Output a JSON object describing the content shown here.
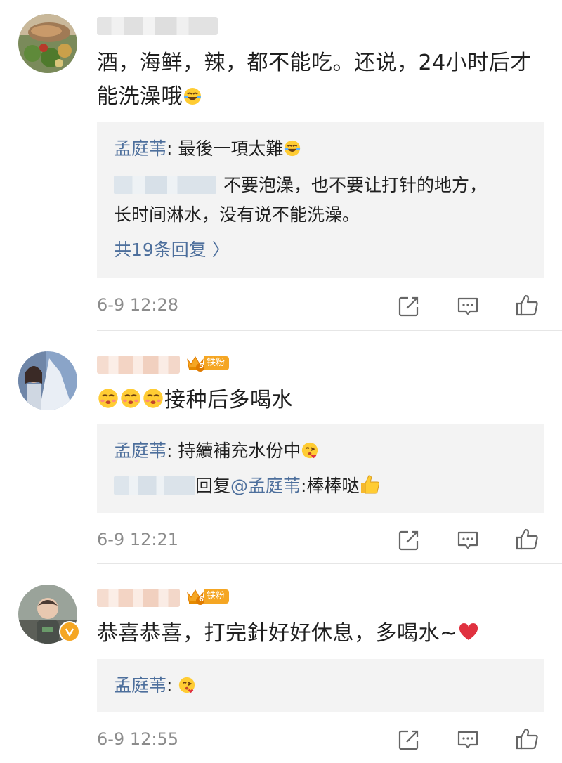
{
  "comments": [
    {
      "text": "酒，海鲜，辣，都不能吃。还说，24小时后才能洗澡哦",
      "replies": [
        {
          "name": "孟庭苇",
          "sep": ": ",
          "text": "最後一項太難"
        },
        {
          "text": "不要泡澡，也不要让打针的地方，",
          "text2": "长时间淋水，没有说不能洗澡。"
        }
      ],
      "more": "共19条回复 〉",
      "time": "6-9 12:28"
    },
    {
      "badge": {
        "level": "5",
        "label": "铁粉"
      },
      "text": "接种后多喝水",
      "replies": [
        {
          "name": "孟庭苇",
          "sep": ": ",
          "text": "持續補充水份中"
        },
        {
          "prefix": "回复",
          "mention": "@孟庭苇",
          "text": ":棒棒哒"
        }
      ],
      "time": "6-9 12:21"
    },
    {
      "badge": {
        "level": "6",
        "label": "铁粉"
      },
      "text": "恭喜恭喜，打完針好好休息，多喝水~",
      "replies": [
        {
          "name": "孟庭苇",
          "sep": ": "
        }
      ],
      "time": "6-9 12:55"
    }
  ],
  "icons": [
    "repost-icon",
    "comment-icon",
    "like-icon"
  ],
  "colors": {
    "link": "#4d6f9c",
    "badge": "#f5a623",
    "reply_bg": "#f3f3f3",
    "heart": "#e0313f"
  }
}
